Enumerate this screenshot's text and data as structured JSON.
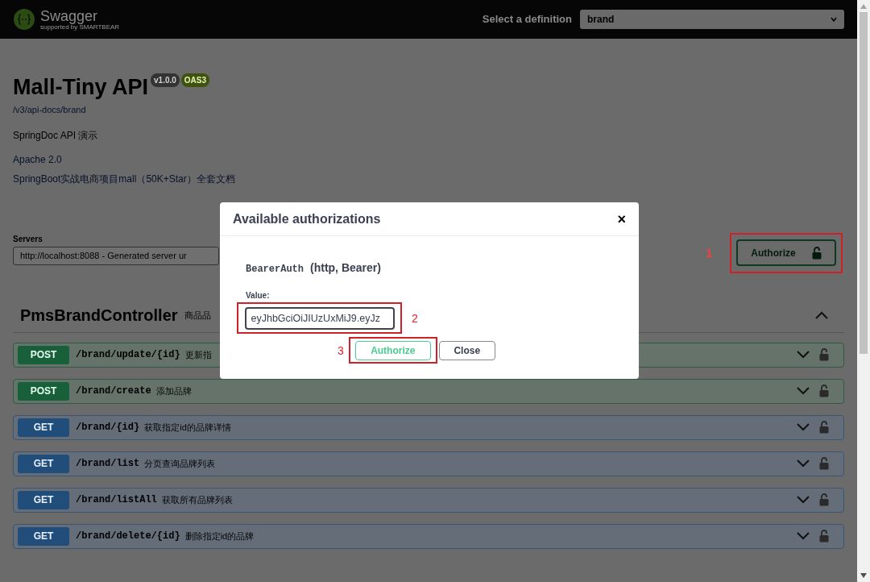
{
  "header": {
    "logo_text": "Swagger",
    "logo_subtext": "supported by SMARTBEAR",
    "definition_label": "Select a definition",
    "definition_value": "brand"
  },
  "info": {
    "title": "Mall-Tiny API",
    "version": "v1.0.0",
    "oas_badge": "OAS3",
    "spec_link": "/v3/api-docs/brand",
    "description": "SpringDoc API 演示",
    "license_link": "Apache 2.0",
    "docs_link": "SpringBoot实战电商项目mall（50K+Star）全套文档"
  },
  "servers": {
    "label": "Servers",
    "value": "http://localhost:8088 - Generated server ur"
  },
  "authorize_button": {
    "label": "Authorize",
    "annotation": "1"
  },
  "tag_section": {
    "name": "PmsBrandController",
    "description": "商品品",
    "expanded": true
  },
  "operations": [
    {
      "method": "POST",
      "path": "/brand/update/{id}",
      "summary": "更新指"
    },
    {
      "method": "POST",
      "path": "/brand/create",
      "summary": "添加品牌"
    },
    {
      "method": "GET",
      "path": "/brand/{id}",
      "summary": "获取指定id的品牌详情"
    },
    {
      "method": "GET",
      "path": "/brand/list",
      "summary": "分页查询品牌列表"
    },
    {
      "method": "GET",
      "path": "/brand/listAll",
      "summary": "获取所有品牌列表"
    },
    {
      "method": "GET",
      "path": "/brand/delete/{id}",
      "summary": "删除指定id的品牌"
    }
  ],
  "modal": {
    "title": "Available authorizations",
    "close_glyph": "×",
    "scheme_name": "BearerAuth",
    "scheme_type": "(http, Bearer)",
    "value_label": "Value:",
    "value": "eyJhbGciOiJIUzUxMiJ9.eyJz",
    "value_annotation": "2",
    "authorize_label": "Authorize",
    "authorize_annotation": "3",
    "close_label": "Close"
  }
}
